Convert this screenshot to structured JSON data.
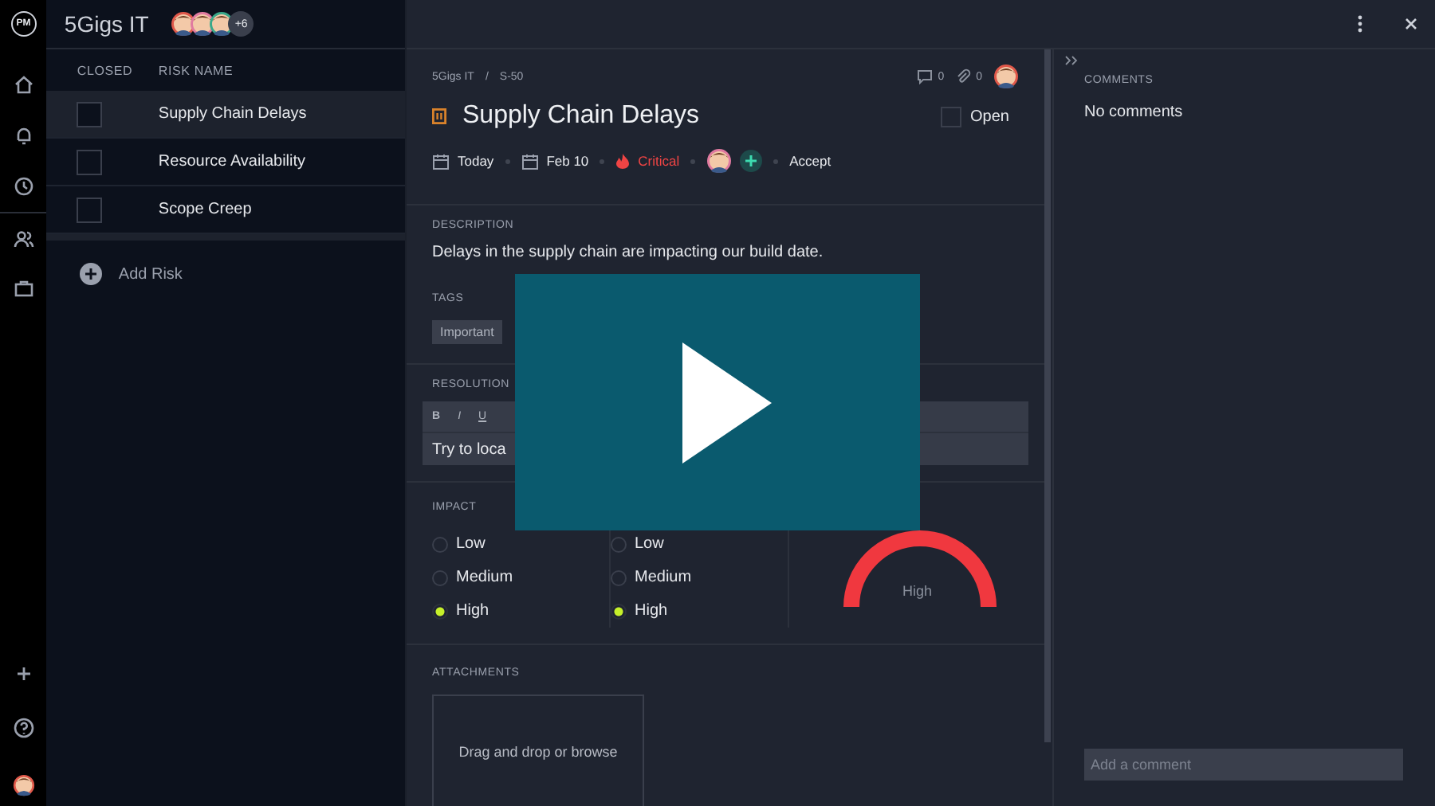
{
  "app": {
    "logo": "PM",
    "project": "5Gigs IT",
    "members_more": "+6"
  },
  "table": {
    "columns": [
      "CLOSED",
      "RISK NAME"
    ],
    "rows": [
      {
        "name": "Supply Chain Delays",
        "closed": false,
        "selected": true
      },
      {
        "name": "Resource Availability",
        "closed": false,
        "selected": false
      },
      {
        "name": "Scope Creep",
        "closed": false,
        "selected": false
      }
    ]
  },
  "add_risk": "Add Risk",
  "detail": {
    "breadcrumb": [
      "5Gigs IT",
      "/",
      "S-50"
    ],
    "comment_count": "0",
    "attachment_count": "0",
    "title": "Supply Chain Delays",
    "status": {
      "label": "Open",
      "checked": false
    },
    "start": "Today",
    "due": "Feb 10",
    "priority": "Critical",
    "response": "Accept",
    "description": {
      "label": "DESCRIPTION",
      "text": "Delays in the supply chain are impacting our build date."
    },
    "tags": {
      "label": "TAGS",
      "items": [
        "Important"
      ]
    },
    "resolution": {
      "label": "RESOLUTION",
      "toolbar": [
        "B",
        "I",
        "U"
      ],
      "text": "Try to loca"
    },
    "impact": {
      "label": "IMPACT",
      "options": [
        {
          "label": "Low",
          "selected": false
        },
        {
          "label": "Medium",
          "selected": false
        },
        {
          "label": "High",
          "selected": true
        }
      ]
    },
    "likelihood": {
      "options": [
        {
          "label": "Low",
          "selected": false
        },
        {
          "label": "Medium",
          "selected": false
        },
        {
          "label": "High",
          "selected": true
        }
      ]
    },
    "level": {
      "value": "High"
    },
    "attachments": {
      "label": "ATTACHMENTS",
      "dropzone": "Drag and drop or browse"
    }
  },
  "comments": {
    "title": "COMMENTS",
    "empty": "No comments",
    "placeholder": "Add a comment"
  }
}
